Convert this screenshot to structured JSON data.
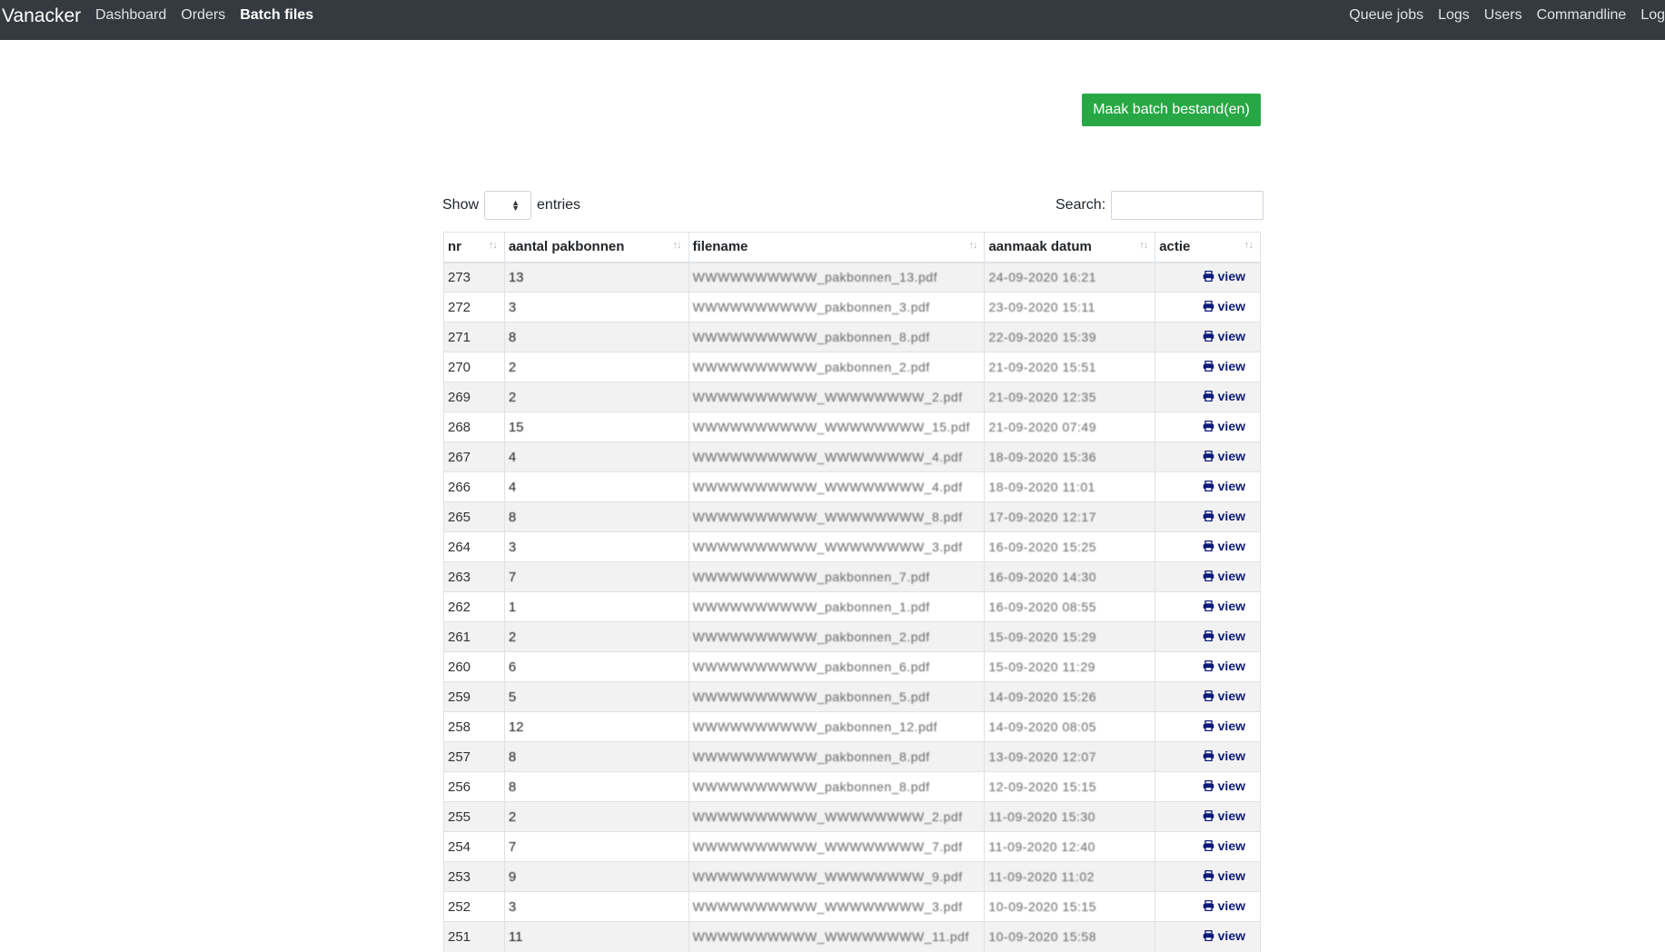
{
  "navbar": {
    "brand": "Vanacker",
    "left_items": [
      {
        "label": "Dashboard",
        "active": false
      },
      {
        "label": "Orders",
        "active": false
      },
      {
        "label": "Batch files",
        "active": true
      }
    ],
    "right_items": [
      {
        "label": "Queue jobs"
      },
      {
        "label": "Logs"
      },
      {
        "label": "Users"
      },
      {
        "label": "Commandline"
      },
      {
        "label": "Log"
      }
    ]
  },
  "make_button": {
    "label": "Maak batch bestand(en)"
  },
  "length_control": {
    "show_label": "Show",
    "entries_label": "entries"
  },
  "search": {
    "label": "Search:",
    "value": ""
  },
  "table": {
    "headers": [
      "nr",
      "aantal pakbonnen",
      "filename",
      "aanmaak datum",
      "actie"
    ],
    "action_label": "view",
    "rows": [
      {
        "nr": "273",
        "count": "13",
        "filename": "WWWWWWWWWW_pakbonnen_13.pdf",
        "date": "24-09-2020 16:21"
      },
      {
        "nr": "272",
        "count": "3",
        "filename": "WWWWWWWWWW_pakbonnen_3.pdf",
        "date": "23-09-2020 15:11"
      },
      {
        "nr": "271",
        "count": "8",
        "filename": "WWWWWWWWWW_pakbonnen_8.pdf",
        "date": "22-09-2020 15:39"
      },
      {
        "nr": "270",
        "count": "2",
        "filename": "WWWWWWWWWW_pakbonnen_2.pdf",
        "date": "21-09-2020 15:51"
      },
      {
        "nr": "269",
        "count": "2",
        "filename": "WWWWWWWWWW_WWWWWWWW_2.pdf",
        "date": "21-09-2020 12:35"
      },
      {
        "nr": "268",
        "count": "15",
        "filename": "WWWWWWWWWW_WWWWWWWW_15.pdf",
        "date": "21-09-2020 07:49"
      },
      {
        "nr": "267",
        "count": "4",
        "filename": "WWWWWWWWWW_WWWWWWWW_4.pdf",
        "date": "18-09-2020 15:36"
      },
      {
        "nr": "266",
        "count": "4",
        "filename": "WWWWWWWWWW_WWWWWWWW_4.pdf",
        "date": "18-09-2020 11:01"
      },
      {
        "nr": "265",
        "count": "8",
        "filename": "WWWWWWWWWW_WWWWWWWW_8.pdf",
        "date": "17-09-2020 12:17"
      },
      {
        "nr": "264",
        "count": "3",
        "filename": "WWWWWWWWWW_WWWWWWWW_3.pdf",
        "date": "16-09-2020 15:25"
      },
      {
        "nr": "263",
        "count": "7",
        "filename": "WWWWWWWWWW_pakbonnen_7.pdf",
        "date": "16-09-2020 14:30"
      },
      {
        "nr": "262",
        "count": "1",
        "filename": "WWWWWWWWWW_pakbonnen_1.pdf",
        "date": "16-09-2020 08:55"
      },
      {
        "nr": "261",
        "count": "2",
        "filename": "WWWWWWWWWW_pakbonnen_2.pdf",
        "date": "15-09-2020 15:29"
      },
      {
        "nr": "260",
        "count": "6",
        "filename": "WWWWWWWWWW_pakbonnen_6.pdf",
        "date": "15-09-2020 11:29"
      },
      {
        "nr": "259",
        "count": "5",
        "filename": "WWWWWWWWWW_pakbonnen_5.pdf",
        "date": "14-09-2020 15:26"
      },
      {
        "nr": "258",
        "count": "12",
        "filename": "WWWWWWWWWW_pakbonnen_12.pdf",
        "date": "14-09-2020 08:05"
      },
      {
        "nr": "257",
        "count": "8",
        "filename": "WWWWWWWWWW_pakbonnen_8.pdf",
        "date": "13-09-2020 12:07"
      },
      {
        "nr": "256",
        "count": "8",
        "filename": "WWWWWWWWWW_pakbonnen_8.pdf",
        "date": "12-09-2020 15:15"
      },
      {
        "nr": "255",
        "count": "2",
        "filename": "WWWWWWWWWW_WWWWWWWW_2.pdf",
        "date": "11-09-2020 15:30"
      },
      {
        "nr": "254",
        "count": "7",
        "filename": "WWWWWWWWWW_WWWWWWWW_7.pdf",
        "date": "11-09-2020 12:40"
      },
      {
        "nr": "253",
        "count": "9",
        "filename": "WWWWWWWWWW_WWWWWWWW_9.pdf",
        "date": "11-09-2020 11:02"
      },
      {
        "nr": "252",
        "count": "3",
        "filename": "WWWWWWWWWW_WWWWWWWW_3.pdf",
        "date": "10-09-2020 15:15"
      },
      {
        "nr": "251",
        "count": "11",
        "filename": "WWWWWWWWWW_WWWWWWWW_11.pdf",
        "date": "10-09-2020 15:58"
      }
    ]
  }
}
